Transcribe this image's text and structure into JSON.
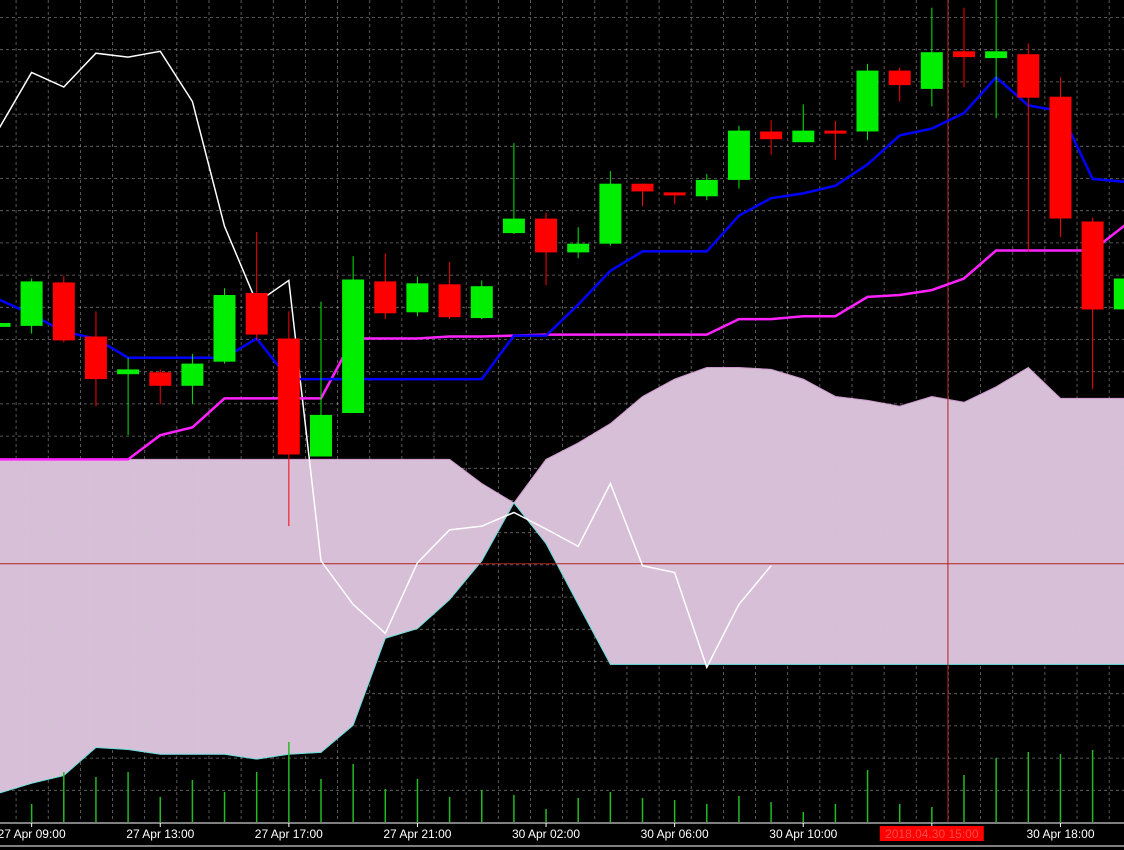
{
  "chart_data": {
    "type": "candlestick",
    "colors": {
      "background": "#000000",
      "grid": "#c8c8c8",
      "bull": "#00ee00",
      "bear": "#ff0000",
      "tenkan": "#0000ff",
      "kijun": "#ff22ff",
      "chikou": "#ffffff",
      "kumo_bull": "#00ffff",
      "kumo_bear": "#d8bfd8",
      "volume": "#22bb22",
      "crosshair": "#b22222",
      "date_highlight_bg": "#ff0000"
    },
    "ylim": [
      0,
      850
    ],
    "grid": true,
    "x_tick_labels": [
      {
        "i": 1,
        "text": "27 Apr 09:00"
      },
      {
        "i": 5,
        "text": "27 Apr 13:00"
      },
      {
        "i": 9,
        "text": "27 Apr 17:00"
      },
      {
        "i": 13,
        "text": "27 Apr 21:00"
      },
      {
        "i": 17,
        "text": "30 Apr 02:00"
      },
      {
        "i": 21,
        "text": "30 Apr 06:00"
      },
      {
        "i": 25,
        "text": "30 Apr 10:00"
      },
      {
        "i": 29,
        "text": "2018.04.30 15:00",
        "highlight": true
      },
      {
        "i": 33,
        "text": "30 Apr 18:00"
      }
    ],
    "crosshair": {
      "i": 29.5,
      "y": 267
    },
    "candles": [
      {
        "open": 512,
        "close": 516,
        "high": 525,
        "low": 505
      },
      {
        "open": 513,
        "close": 559,
        "high": 562,
        "low": 505
      },
      {
        "open": 558,
        "close": 498,
        "high": 565,
        "low": 496
      },
      {
        "open": 502,
        "close": 458,
        "high": 528,
        "low": 430
      },
      {
        "open": 463,
        "close": 468,
        "high": 480,
        "low": 400
      },
      {
        "open": 465,
        "close": 451,
        "high": 468,
        "low": 432
      },
      {
        "open": 451,
        "close": 474,
        "high": 484,
        "low": 432
      },
      {
        "open": 476,
        "close": 545,
        "high": 552,
        "low": 474
      },
      {
        "open": 547,
        "close": 504,
        "high": 610,
        "low": 498
      },
      {
        "open": 500,
        "close": 380,
        "high": 528,
        "low": 306
      },
      {
        "open": 378,
        "close": 421,
        "high": 538,
        "low": 378
      },
      {
        "open": 423,
        "close": 561,
        "high": 585,
        "low": 423
      },
      {
        "open": 559,
        "close": 526,
        "high": 588,
        "low": 520
      },
      {
        "open": 527,
        "close": 557,
        "high": 564,
        "low": 523
      },
      {
        "open": 556,
        "close": 522,
        "high": 579,
        "low": 520
      },
      {
        "open": 521,
        "close": 554,
        "high": 560,
        "low": 520
      },
      {
        "open": 609,
        "close": 624,
        "high": 702,
        "low": 608
      },
      {
        "open": 624,
        "close": 589,
        "high": 630,
        "low": 555
      },
      {
        "open": 589,
        "close": 598,
        "high": 615,
        "low": 583
      },
      {
        "open": 598,
        "close": 660,
        "high": 673,
        "low": 596
      },
      {
        "open": 660,
        "close": 652,
        "high": 660,
        "low": 637
      },
      {
        "open": 651,
        "close": 649,
        "high": 651,
        "low": 639
      },
      {
        "open": 647,
        "close": 664,
        "high": 670,
        "low": 643
      },
      {
        "open": 664,
        "close": 715,
        "high": 720,
        "low": 655
      },
      {
        "open": 714,
        "close": 706,
        "high": 726,
        "low": 690
      },
      {
        "open": 703,
        "close": 715,
        "high": 742,
        "low": 703
      },
      {
        "open": 715,
        "close": 713,
        "high": 725,
        "low": 685
      },
      {
        "open": 714,
        "close": 777,
        "high": 784,
        "low": 705
      },
      {
        "open": 777,
        "close": 762,
        "high": 780,
        "low": 745
      },
      {
        "open": 758,
        "close": 796,
        "high": 842,
        "low": 740
      },
      {
        "open": 797,
        "close": 791,
        "high": 842,
        "low": 760
      },
      {
        "open": 790,
        "close": 797,
        "high": 850,
        "low": 728
      },
      {
        "open": 794,
        "close": 749,
        "high": 805,
        "low": 590
      },
      {
        "open": 750,
        "close": 624,
        "high": 770,
        "low": 605
      },
      {
        "open": 621,
        "close": 530,
        "high": 625,
        "low": 448
      },
      {
        "open": 530,
        "close": 562,
        "high": 580,
        "low": 470
      }
    ],
    "tenkan": [
      540,
      525,
      507,
      500,
      480,
      480,
      480,
      480,
      500,
      458,
      458,
      458,
      458,
      458,
      458,
      458,
      503,
      503,
      535,
      570,
      590,
      590,
      590,
      627,
      645,
      650,
      658,
      680,
      710,
      717,
      733,
      770,
      741,
      735,
      665,
      662
    ],
    "kijun": [
      375,
      375,
      375,
      375,
      375,
      400,
      408,
      438,
      438,
      438,
      438,
      500,
      500,
      500,
      502,
      502,
      503,
      504,
      504,
      504,
      504,
      504,
      504,
      520,
      520,
      523,
      523,
      543,
      545,
      550,
      562,
      591,
      591,
      591,
      591,
      617
    ],
    "chikou": [
      718,
      775,
      760,
      795,
      791,
      797,
      745,
      616,
      537,
      560,
      270,
      225,
      195,
      268,
      302,
      306,
      320,
      303,
      285,
      350,
      265,
      258,
      160,
      225,
      265
    ],
    "kumo": {
      "top": [
        375,
        375,
        375,
        375,
        375,
        375,
        375,
        375,
        375,
        375,
        375,
        375,
        375,
        375,
        375,
        350,
        330,
        375,
        392,
        412,
        440,
        458,
        470,
        470,
        468,
        458,
        440,
        436,
        430,
        440,
        434,
        450,
        470,
        438,
        438,
        438
      ],
      "bottom": [
        30,
        40,
        48,
        77,
        75,
        70,
        70,
        70,
        65,
        70,
        72,
        100,
        190,
        200,
        230,
        270,
        330,
        288,
        225,
        163,
        163,
        163,
        163,
        163,
        163,
        163,
        163,
        163,
        163,
        163,
        163,
        163,
        163,
        163,
        163,
        163
      ]
    },
    "volume": [
      30,
      18,
      50,
      45,
      50,
      25,
      42,
      30,
      50,
      80,
      43,
      58,
      33,
      43,
      25,
      32,
      27,
      13,
      24,
      30,
      24,
      22,
      18,
      26,
      20,
      10,
      18,
      52,
      18,
      15,
      47,
      64,
      70,
      68,
      72,
      42
    ]
  }
}
